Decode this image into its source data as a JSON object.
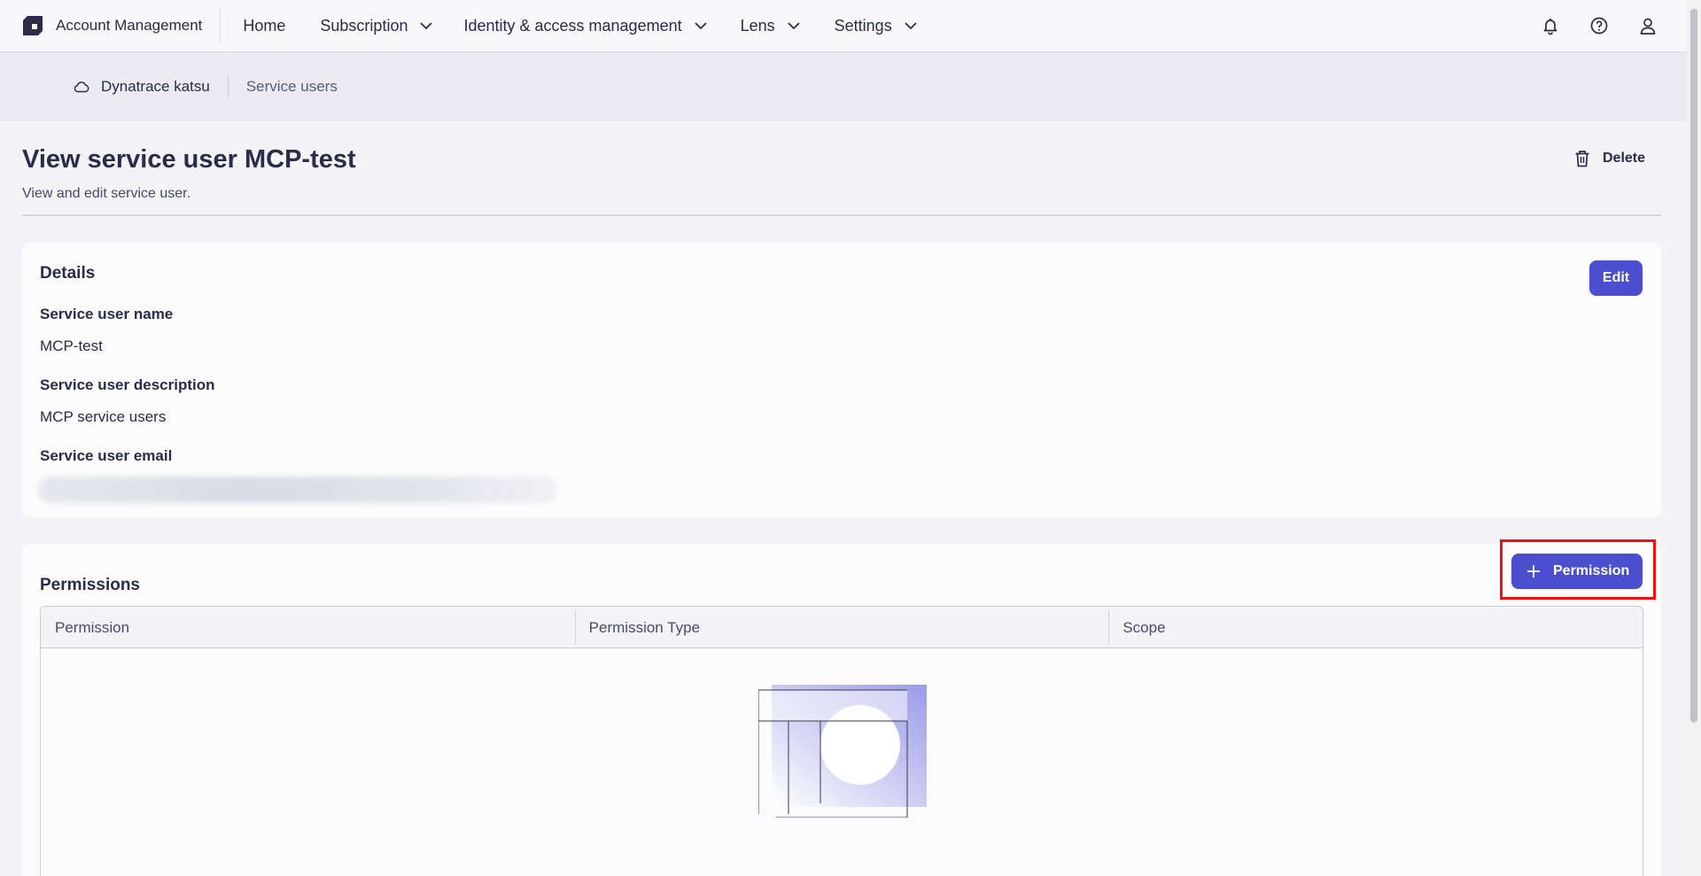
{
  "app": {
    "title": "Account Management"
  },
  "nav": {
    "items": [
      {
        "label": "Home",
        "has_dropdown": false
      },
      {
        "label": "Subscription",
        "has_dropdown": true
      },
      {
        "label": "Identity & access management",
        "has_dropdown": true
      },
      {
        "label": "Lens",
        "has_dropdown": true
      },
      {
        "label": "Settings",
        "has_dropdown": true
      }
    ],
    "right_icons": [
      "bell-icon",
      "help-icon",
      "user-icon"
    ]
  },
  "breadcrumb": {
    "environment": "Dynatrace katsu",
    "current": "Service users"
  },
  "page": {
    "title": "View service user MCP-test",
    "subtitle": "View and edit service user.",
    "delete_label": "Delete"
  },
  "details": {
    "heading": "Details",
    "edit_label": "Edit",
    "fields": [
      {
        "label": "Service user name",
        "value": "MCP-test"
      },
      {
        "label": "Service user description",
        "value": "MCP service users"
      },
      {
        "label": "Service user email",
        "value": ""
      }
    ]
  },
  "permissions": {
    "heading": "Permissions",
    "add_label": "Permission",
    "columns": [
      "Permission",
      "Permission Type",
      "Scope"
    ],
    "rows": []
  },
  "colors": {
    "primary": "#4b4fcf",
    "highlight": "#ee1111",
    "background": "#f3f3f8"
  }
}
